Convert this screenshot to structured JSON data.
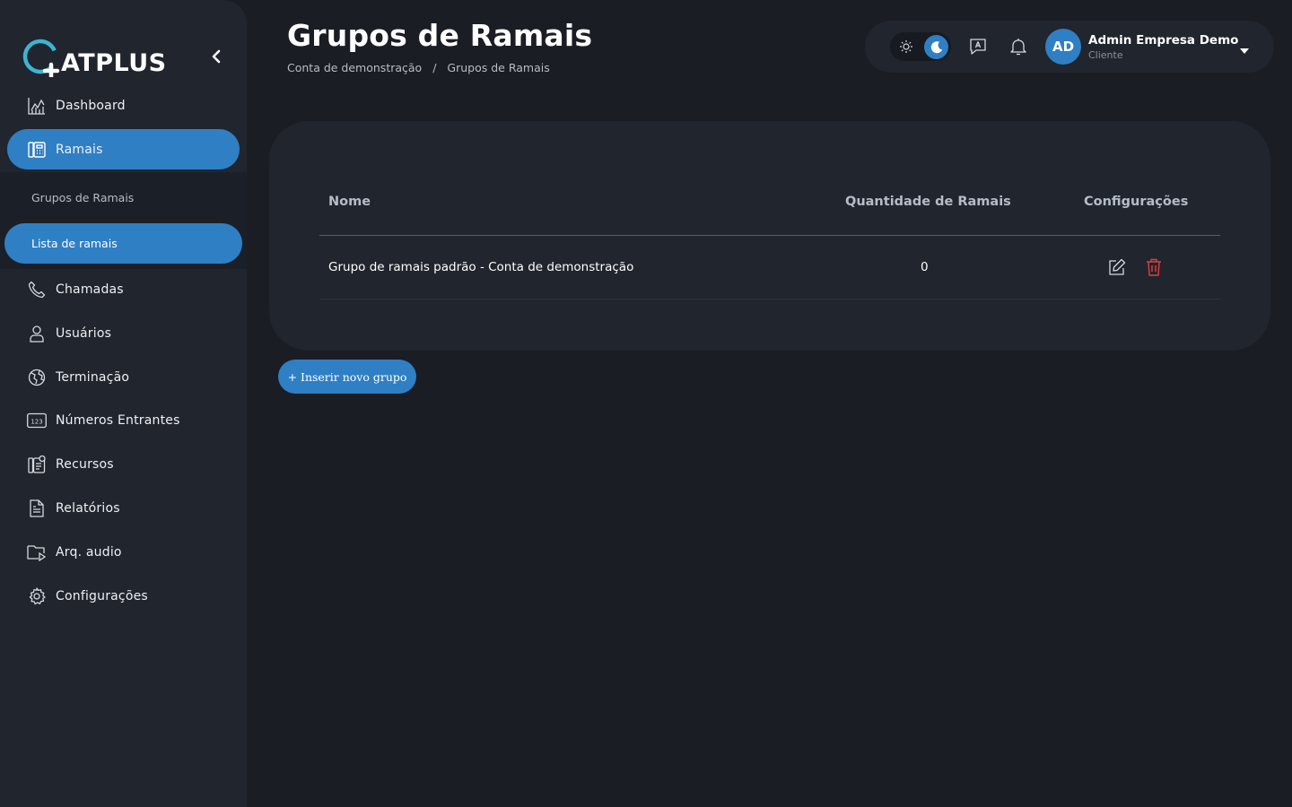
{
  "brand": {
    "logo_text": "ATPLUS",
    "accent": "#2f7fc4"
  },
  "sidebar": {
    "items": [
      {
        "label": "Dashboard",
        "icon": "chart-icon"
      },
      {
        "label": "Ramais",
        "icon": "phonebook-icon",
        "active": true
      },
      {
        "label": "Chamadas",
        "icon": "phone-icon"
      },
      {
        "label": "Usuários",
        "icon": "user-icon"
      },
      {
        "label": "Terminação",
        "icon": "globe-icon"
      },
      {
        "label": "Números Entrantes",
        "icon": "numbers-icon"
      },
      {
        "label": "Recursos",
        "icon": "resources-icon"
      },
      {
        "label": "Relatórios",
        "icon": "document-icon"
      },
      {
        "label": "Arq. audio",
        "icon": "audio-folder-icon"
      },
      {
        "label": "Configurações",
        "icon": "gear-icon"
      }
    ],
    "submenu": [
      {
        "label": "Grupos de Ramais"
      },
      {
        "label": "Lista de ramais",
        "active": true
      }
    ]
  },
  "header": {
    "title": "Grupos de Ramais",
    "breadcrumb": [
      "Conta de demonstração",
      "/",
      "Grupos de Ramais"
    ]
  },
  "user": {
    "initials": "AD",
    "name": "Admin Empresa Demo",
    "role": "Cliente"
  },
  "table": {
    "columns": [
      "Nome",
      "Quantidade de Ramais",
      "Configurações"
    ],
    "rows": [
      {
        "name": "Grupo de ramais padrão - Conta de demonstração",
        "count": "0"
      }
    ]
  },
  "actions": {
    "add_group": "+ Inserir novo grupo"
  },
  "colors": {
    "danger": "#e0403a",
    "background": "#1a1d24",
    "panel": "#20252e"
  }
}
